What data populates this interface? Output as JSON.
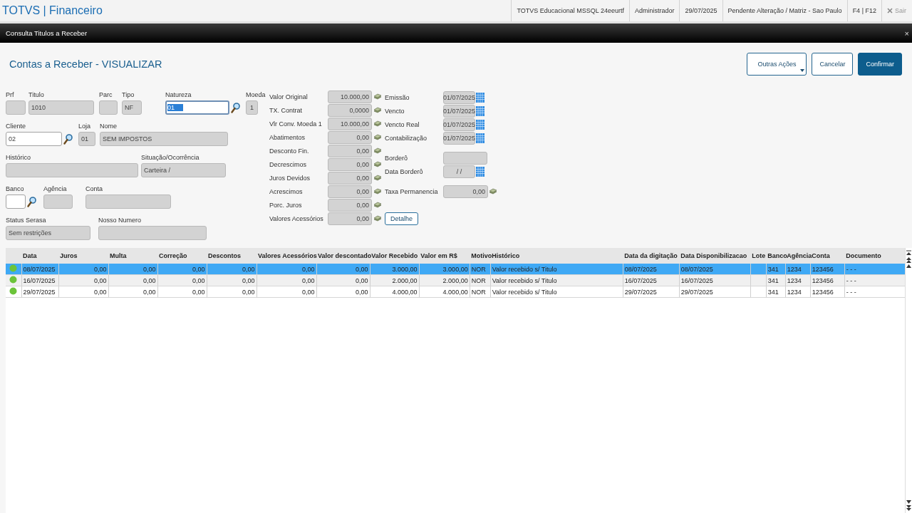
{
  "app": {
    "title": "TOTVS | Financeiro",
    "status_items": [
      "TOTVS Educacional MSSQL 24eeurtf",
      "Administrador",
      "29/07/2025",
      "Pendente Alteração / Matriz - Sao Paulo",
      "F4 | F12"
    ],
    "exit_label": "Sair"
  },
  "window": {
    "title": "Consulta Titulos a Receber",
    "close": "×"
  },
  "page": {
    "title": "Contas a Receber - VISUALIZAR",
    "buttons": [
      {
        "label": "Outras Ações",
        "kind": "menu"
      },
      {
        "label": "Cancelar",
        "kind": "secondary"
      },
      {
        "label": "Confirmar",
        "kind": "primary"
      }
    ]
  },
  "form_rows": [
    [
      {
        "label": "Prf",
        "kind": "readonly",
        "lookup": false
      },
      {
        "label": "Titulo",
        "value": "1010",
        "kind": "readonly",
        "lookup": false
      },
      {
        "label": "Parc",
        "kind": "readonly",
        "lookup": false
      },
      {
        "label": "Tipo",
        "value": "NF",
        "kind": "readonly",
        "lookup": false
      },
      {
        "label": "Natureza",
        "value": "01",
        "kind": "focused",
        "lookup": true
      },
      {
        "label": "Moeda",
        "value": "1",
        "kind": "readonly",
        "lookup": false
      }
    ],
    [
      {
        "label": "Cliente",
        "value": "02",
        "kind": "input",
        "lookup": true
      },
      {
        "label": "Loja",
        "value": "01",
        "kind": "readonly",
        "lookup": false
      },
      {
        "label": "Nome",
        "value": "SEM IMPOSTOS",
        "kind": "readonly",
        "lookup": false
      }
    ],
    [
      {
        "label": "Histórico",
        "kind": "readonly",
        "lookup": false
      },
      {
        "label": "Situação/Ocorrência",
        "value": "Carteira /",
        "kind": "readonly",
        "lookup": false
      }
    ],
    [
      {
        "label": "Banco",
        "kind": "input",
        "lookup": true
      },
      {
        "label": "Agência",
        "kind": "readonly",
        "lookup": false
      },
      {
        "label": "Conta",
        "kind": "readonly",
        "lookup": false
      }
    ],
    [
      {
        "label": "Status Serasa",
        "value": "Sem restrições",
        "kind": "readonly",
        "lookup": false
      },
      {
        "label": "Nosso Numero",
        "kind": "readonly",
        "lookup": false
      }
    ]
  ],
  "values": [
    {
      "label": "Valor Original",
      "value": "10.000,00"
    },
    {
      "label": "TX. Contrat",
      "value": "0,0000"
    },
    {
      "label": "Vlr Conv. Moeda 1",
      "value": "10.000,00"
    },
    {
      "label": "Abatimentos",
      "value": "0,00"
    },
    {
      "label": "Desconto Fin.",
      "value": "0,00"
    },
    {
      "label": "Decrescimos",
      "value": "0,00"
    },
    {
      "label": "Juros Devidos",
      "value": "0,00"
    },
    {
      "label": "Acrescimos",
      "value": "0,00"
    },
    {
      "label": "Porc. Juros",
      "value": "0,00"
    },
    {
      "label": "Valores Acessórios",
      "value": "0,00"
    }
  ],
  "dates": [
    {
      "label": "Emissão",
      "value": "01/07/2025",
      "kind": "date"
    },
    {
      "label": "Vencto",
      "value": "01/07/2025",
      "kind": "date"
    },
    {
      "label": "Vencto Real",
      "value": "01/07/2025",
      "kind": "date"
    },
    {
      "label": "Contabilização",
      "value": "01/07/2025",
      "kind": "date"
    },
    {
      "label": "Borderô",
      "kind": "text"
    },
    {
      "label": "Data Borderô",
      "value": " / /",
      "kind": "date"
    },
    {
      "label": "Taxa Permanencia",
      "value": "0,00",
      "kind": "currency"
    },
    {
      "label": "Detalhe",
      "kind": "button"
    }
  ],
  "grid": {
    "columns": [
      "Data",
      "Juros",
      "Multa",
      "Correção",
      "Descontos",
      "Valores Acessórios",
      "Valor descontado",
      "Valor Recebido",
      "Valor em R$",
      "Motivo",
      "Histórico",
      "Data da digitação",
      "Data Disponibilizacao",
      "Lote",
      "Banco",
      "Agência",
      "Conta",
      "Documento"
    ],
    "rows": [
      {
        "selected": true,
        "color": "#6cc43a",
        "cells": [
          "08/07/2025",
          "0,00",
          "0,00",
          "0,00",
          "0,00",
          "0,00",
          "0,00",
          "3.000,00",
          "3.000,00",
          "NOR",
          "Valor recebido s/ Titulo",
          "08/07/2025",
          "08/07/2025",
          null,
          "341",
          "1234",
          "123456",
          "- - -"
        ]
      },
      {
        "selected": false,
        "color": "#6cc43a",
        "cells": [
          "16/07/2025",
          "0,00",
          "0,00",
          "0,00",
          "0,00",
          "0,00",
          "0,00",
          "2.000,00",
          "2.000,00",
          "NOR",
          "Valor recebido s/ Titulo",
          "16/07/2025",
          "16/07/2025",
          null,
          "341",
          "1234",
          "123456",
          "- - -"
        ]
      },
      {
        "selected": false,
        "color": "#6cc43a",
        "cells": [
          "29/07/2025",
          "0,00",
          "0,00",
          "0,00",
          "0,00",
          "0,00",
          "0,00",
          "4.000,00",
          "4.000,00",
          "NOR",
          "Valor recebido s/ Titulo",
          "29/07/2025",
          "29/07/2025",
          null,
          "341",
          "1234",
          "123456",
          "- - -"
        ]
      }
    ]
  }
}
